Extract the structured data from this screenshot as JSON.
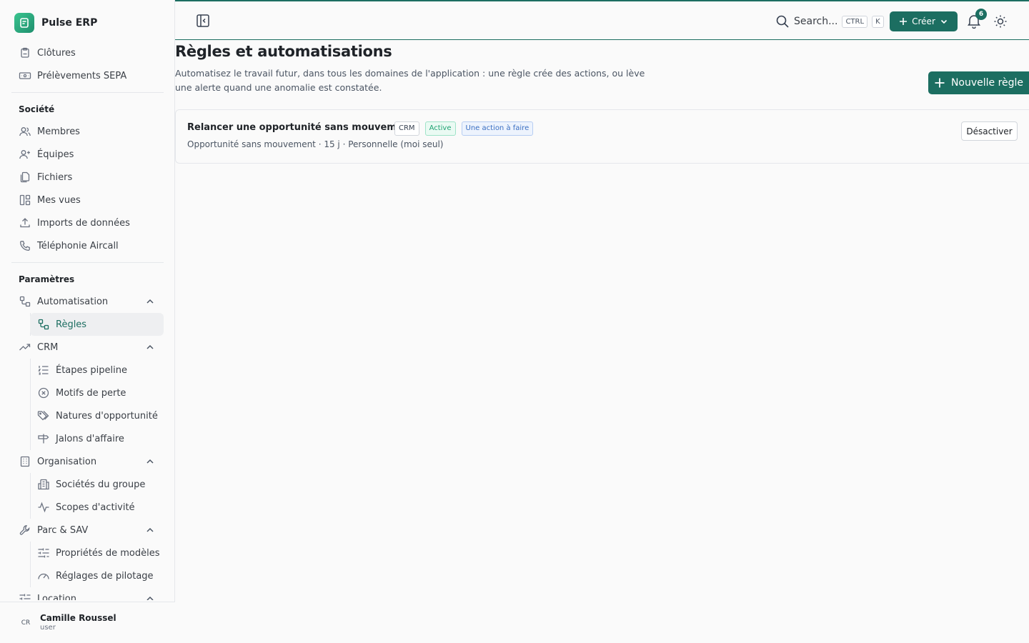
{
  "app": {
    "name": "Pulse ERP"
  },
  "sidebar": {
    "top_items": [
      {
        "label": "Clôtures",
        "icon": "clipboard-icon"
      },
      {
        "label": "Prélèvements SEPA",
        "icon": "banknote-icon"
      }
    ],
    "societe": {
      "heading": "Société",
      "items": [
        {
          "label": "Membres",
          "icon": "users-icon"
        },
        {
          "label": "Équipes",
          "icon": "team-icon"
        },
        {
          "label": "Fichiers",
          "icon": "files-icon"
        },
        {
          "label": "Mes vues",
          "icon": "layout-icon"
        },
        {
          "label": "Imports de données",
          "icon": "upload-icon"
        },
        {
          "label": "Téléphonie Aircall",
          "icon": "phone-icon"
        }
      ]
    },
    "parametres": {
      "heading": "Paramètres",
      "automatisation": {
        "label": "Automatisation",
        "sub": [
          {
            "label": "Règles"
          }
        ]
      },
      "crm": {
        "label": "CRM",
        "sub": [
          {
            "label": "Étapes pipeline"
          },
          {
            "label": "Motifs de perte"
          },
          {
            "label": "Natures d'opportunité"
          },
          {
            "label": "Jalons d'affaire"
          }
        ]
      },
      "organisation": {
        "label": "Organisation",
        "sub": [
          {
            "label": "Sociétés du groupe"
          },
          {
            "label": "Scopes d'activité"
          }
        ]
      },
      "parc": {
        "label": "Parc & SAV",
        "sub": [
          {
            "label": "Propriétés de modèles"
          },
          {
            "label": "Réglages de pilotage"
          }
        ]
      },
      "location": {
        "label": "Location"
      }
    },
    "user": {
      "initials": "CR",
      "name": "Camille Roussel",
      "role": "user"
    }
  },
  "topbar": {
    "search_label": "Search...",
    "kbd": [
      "CTRL",
      "K"
    ],
    "create_label": "Créer",
    "notifications_count": "6"
  },
  "main": {
    "title": "Règles et automatisations",
    "description": "Automatisez le travail futur, dans tous les domaines de l'application : une règle crée des actions, ou lève une alerte quand une anomalie est constatée.",
    "new_rule_label": "Nouvelle règle",
    "rules": [
      {
        "name": "Relancer une opportunité sans mouvement",
        "tags": [
          "CRM",
          "Active",
          "Une action à faire"
        ],
        "meta": "Opportunité sans mouvement · 15 j · Personnelle (moi seul)",
        "action_label": "Désactiver"
      }
    ]
  },
  "colors": {
    "brand": "#1c6e61",
    "active_tag": "#1fa372",
    "info_tag": "#3a6fc2"
  }
}
